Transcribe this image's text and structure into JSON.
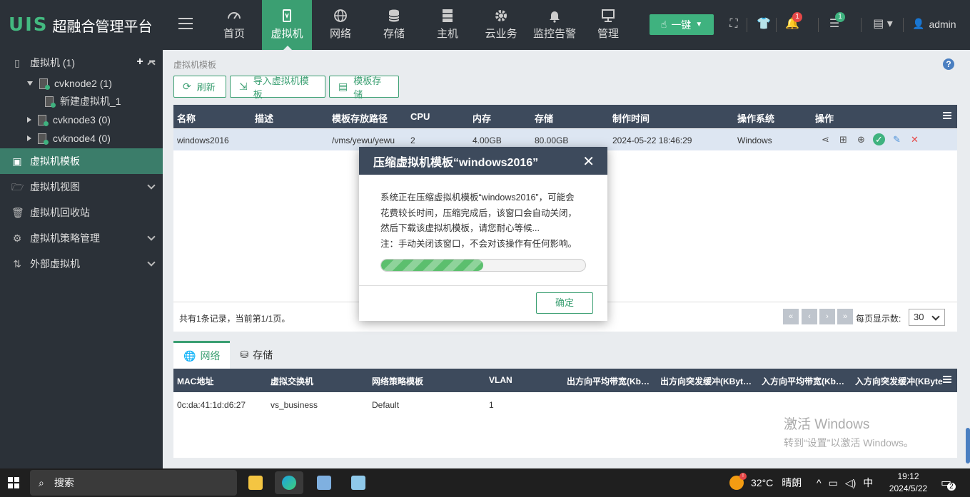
{
  "app": {
    "logo_mark": "UIS",
    "logo_text": "超融合管理平台"
  },
  "nav": {
    "items": [
      {
        "label": "首页",
        "icon": "dashboard-icon"
      },
      {
        "label": "虚拟机",
        "icon": "vm-icon",
        "active": true
      },
      {
        "label": "网络",
        "icon": "globe-icon"
      },
      {
        "label": "存储",
        "icon": "database-icon"
      },
      {
        "label": "主机",
        "icon": "server-icon"
      },
      {
        "label": "云业务",
        "icon": "gear-icon"
      },
      {
        "label": "监控告警",
        "icon": "bell-icon"
      },
      {
        "label": "管理",
        "icon": "monitor-icon"
      }
    ],
    "onekey_label": "一键",
    "alarm_count": "1",
    "task_count": "1",
    "user": "admin"
  },
  "sidebar": {
    "vm_root": "虚拟机 (1)",
    "nodes": [
      {
        "label": "cvknode2 (1)",
        "expanded": true
      },
      {
        "label": "新建虚拟机_1"
      },
      {
        "label": "cvknode3 (0)"
      },
      {
        "label": "cvknode4 (0)"
      }
    ],
    "items": [
      {
        "label": "虚拟机模板",
        "active": true
      },
      {
        "label": "虚拟机视图"
      },
      {
        "label": "虚拟机回收站"
      },
      {
        "label": "虚拟机策略管理"
      },
      {
        "label": "外部虚拟机"
      }
    ]
  },
  "breadcrumb": "虚拟机模板",
  "toolbar": {
    "refresh": "刷新",
    "import": "导入虚拟机模板",
    "storage": "模板存储"
  },
  "table": {
    "headers": [
      "名称",
      "描述",
      "模板存放路径",
      "CPU",
      "内存",
      "存储",
      "制作时间",
      "操作系统",
      "操作"
    ],
    "rows": [
      {
        "name": "windows2016",
        "desc": "",
        "path": "/vms/yewu/yewu",
        "cpu": "2",
        "mem": "4.00GB",
        "storage": "80.00GB",
        "time": "2024-05-22 18:46:29",
        "os": "Windows"
      }
    ],
    "page_info": "共有1条记录，当前第1/1页。",
    "page_size_label": "每页显示数:",
    "page_size": "30"
  },
  "tabs": {
    "network": "网络",
    "storage": "存储"
  },
  "nic_table": {
    "headers": [
      "MAC地址",
      "虚拟交换机",
      "网络策略模板",
      "VLAN",
      "出方向平均带宽(Kb…",
      "出方向突发缓冲(KByt…",
      "入方向平均带宽(Kb…",
      "入方向突发缓冲(KByte"
    ],
    "rows": [
      {
        "mac": "0c:da:41:1d:d6:27",
        "vswitch": "vs_business",
        "policy": "Default",
        "vlan": "1"
      }
    ]
  },
  "modal": {
    "title": "压缩虚拟机模板“windows2016”",
    "line1": "系统正在压缩虚拟机模板“windows2016”，可能会",
    "line2": "花费较长时间，压缩完成后，该窗口会自动关闭，",
    "line3": "然后下载该虚拟机模板，请您耐心等候...",
    "line4": "注：手动关闭该窗口，不会对该操作有任何影响。",
    "progress": 0.5,
    "ok": "确定"
  },
  "watermark": {
    "line1": "激活 Windows",
    "line2": "转到“设置”以激活 Windows。"
  },
  "taskbar": {
    "search": "搜索",
    "weather": "32°C",
    "weather_text": "晴朗",
    "ime": "中",
    "time": "19:12",
    "date": "2024/5/22",
    "notif_count": "2"
  },
  "colors": {
    "accent": "#3b9f72",
    "header_bg": "#2b3138",
    "table_head": "#3d4a5c",
    "danger": "#e64848"
  }
}
